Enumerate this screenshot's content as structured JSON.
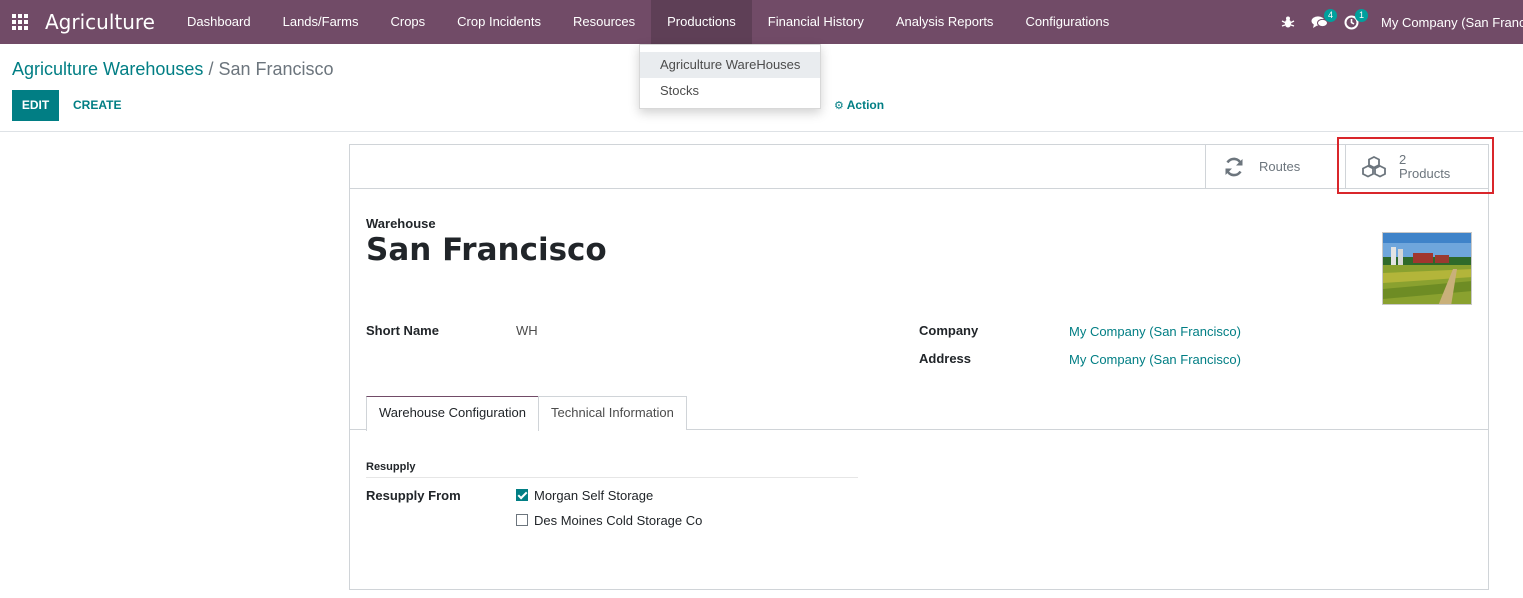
{
  "navbar": {
    "brand": "Agriculture",
    "menu": [
      {
        "label": "Dashboard"
      },
      {
        "label": "Lands/Farms"
      },
      {
        "label": "Crops"
      },
      {
        "label": "Crop Incidents"
      },
      {
        "label": "Resources"
      },
      {
        "label": "Productions"
      },
      {
        "label": "Financial History"
      },
      {
        "label": "Analysis Reports"
      },
      {
        "label": "Configurations"
      }
    ],
    "active_menu": "Productions",
    "messages_count": "4",
    "activities_count": "1",
    "company": "My Company (San Francisco)"
  },
  "dropdown": {
    "items": [
      {
        "label": "Agriculture WareHouses"
      },
      {
        "label": "Stocks"
      }
    ]
  },
  "control_panel": {
    "breadcrumb_parent": "Agriculture Warehouses",
    "breadcrumb_separator": "/",
    "breadcrumb_current": "San Francisco",
    "edit_label": "EDIT",
    "create_label": "CREATE",
    "action_label": "Action"
  },
  "sheet": {
    "stat_buttons": {
      "routes_label": "Routes",
      "products_count": "2",
      "products_label": "Products"
    },
    "record_type_label": "Warehouse",
    "title": "San Francisco",
    "fields": {
      "short_name_label": "Short Name",
      "short_name_value": "WH",
      "company_label": "Company",
      "company_value": "My Company (San Francisco)",
      "address_label": "Address",
      "address_value": "My Company (San Francisco)"
    },
    "tabs": [
      {
        "label": "Warehouse Configuration"
      },
      {
        "label": "Technical Information"
      }
    ],
    "resupply": {
      "group_title": "Resupply",
      "field_label": "Resupply From",
      "options": [
        {
          "label": "Morgan Self Storage",
          "checked": true
        },
        {
          "label": "Des Moines Cold Storage Co",
          "checked": false
        }
      ]
    }
  },
  "colors": {
    "navbar": "#714b67",
    "accent": "#017e84",
    "highlight": "#d9262b"
  }
}
